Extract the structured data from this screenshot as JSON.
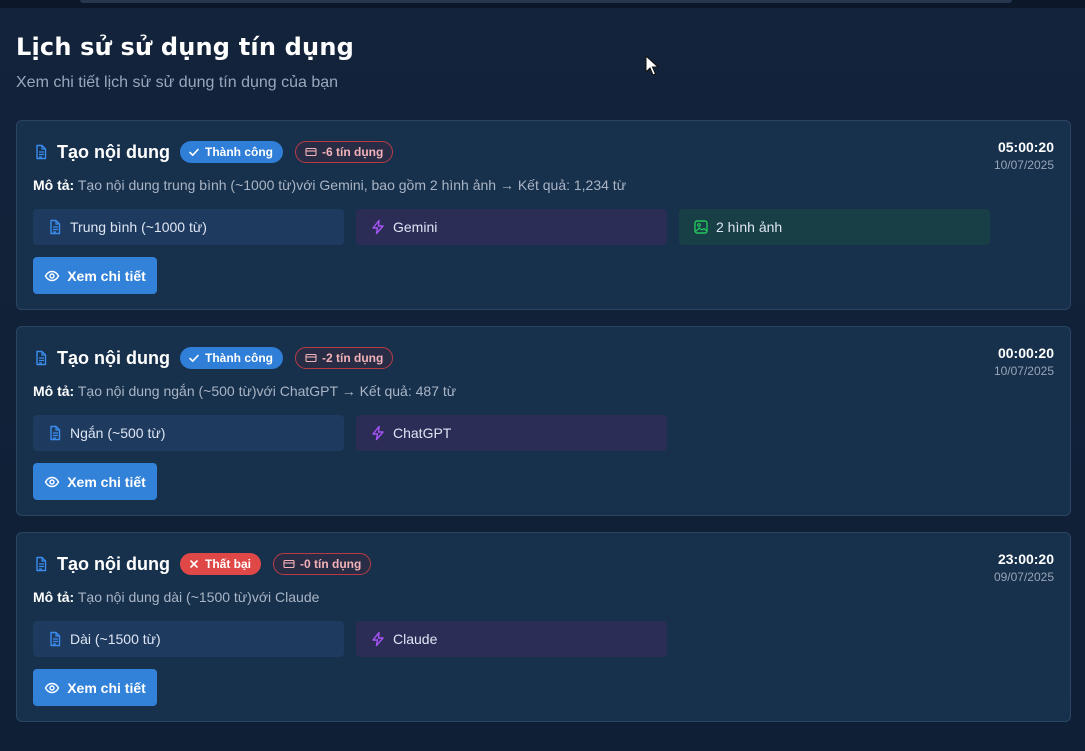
{
  "header": {
    "title": "Lịch sử sử dụng tín dụng",
    "subtitle": "Xem chi tiết lịch sử sử dụng tín dụng của bạn"
  },
  "colors": {
    "accent": "#3282d9",
    "success": "#2f7ed8",
    "fail": "#e04848",
    "credit_border": "#b83c48",
    "chip_length": "#1f3a5f",
    "chip_model": "#2c2d57",
    "chip_images": "#183f45"
  },
  "icons": {
    "title": "document-icon",
    "success": "check-icon",
    "fail": "x-icon",
    "credit": "credit-card-icon",
    "length": "document-icon",
    "model": "lightning-icon",
    "images": "image-icon",
    "detail": "eye-icon"
  },
  "entries": [
    {
      "title": "Tạo nội dung",
      "status": "Thành công",
      "credits": "-6 tín dụng",
      "time": "05:00:20",
      "date": "10/07/2025",
      "desc_label": "Mô tả:",
      "desc_text": "Tạo nội dung trung bình (~1000 từ)với Gemini, bao gồm 2 hình ảnh → Kết quả: 1,234 từ",
      "length": "Trung bình (~1000 từ)",
      "model": "Gemini",
      "images": "2 hình ảnh",
      "button": "Xem chi tiết"
    },
    {
      "title": "Tạo nội dung",
      "status": "Thành công",
      "credits": "-2 tín dụng",
      "time": "00:00:20",
      "date": "10/07/2025",
      "desc_label": "Mô tả:",
      "desc_text": "Tạo nội dung ngắn (~500 từ)với ChatGPT → Kết quả: 487 từ",
      "length": "Ngắn (~500 từ)",
      "model": "ChatGPT",
      "button": "Xem chi tiết"
    },
    {
      "title": "Tạo nội dung",
      "status": "Thất bại",
      "credits": "-0 tín dụng",
      "time": "23:00:20",
      "date": "09/07/2025",
      "desc_label": "Mô tả:",
      "desc_text": "Tạo nội dung dài (~1500 từ)với Claude",
      "length": "Dài (~1500 từ)",
      "model": "Claude",
      "button": "Xem chi tiết"
    }
  ]
}
